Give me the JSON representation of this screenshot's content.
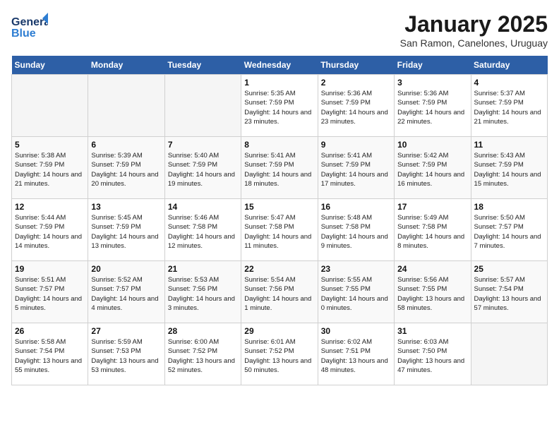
{
  "header": {
    "logo_general": "General",
    "logo_blue": "Blue",
    "month": "January 2025",
    "location": "San Ramon, Canelones, Uruguay"
  },
  "days_of_week": [
    "Sunday",
    "Monday",
    "Tuesday",
    "Wednesday",
    "Thursday",
    "Friday",
    "Saturday"
  ],
  "weeks": [
    [
      {
        "day": "",
        "info": ""
      },
      {
        "day": "",
        "info": ""
      },
      {
        "day": "",
        "info": ""
      },
      {
        "day": "1",
        "info": "Sunrise: 5:35 AM\nSunset: 7:59 PM\nDaylight: 14 hours\nand 23 minutes."
      },
      {
        "day": "2",
        "info": "Sunrise: 5:36 AM\nSunset: 7:59 PM\nDaylight: 14 hours\nand 23 minutes."
      },
      {
        "day": "3",
        "info": "Sunrise: 5:36 AM\nSunset: 7:59 PM\nDaylight: 14 hours\nand 22 minutes."
      },
      {
        "day": "4",
        "info": "Sunrise: 5:37 AM\nSunset: 7:59 PM\nDaylight: 14 hours\nand 21 minutes."
      }
    ],
    [
      {
        "day": "5",
        "info": "Sunrise: 5:38 AM\nSunset: 7:59 PM\nDaylight: 14 hours\nand 21 minutes."
      },
      {
        "day": "6",
        "info": "Sunrise: 5:39 AM\nSunset: 7:59 PM\nDaylight: 14 hours\nand 20 minutes."
      },
      {
        "day": "7",
        "info": "Sunrise: 5:40 AM\nSunset: 7:59 PM\nDaylight: 14 hours\nand 19 minutes."
      },
      {
        "day": "8",
        "info": "Sunrise: 5:41 AM\nSunset: 7:59 PM\nDaylight: 14 hours\nand 18 minutes."
      },
      {
        "day": "9",
        "info": "Sunrise: 5:41 AM\nSunset: 7:59 PM\nDaylight: 14 hours\nand 17 minutes."
      },
      {
        "day": "10",
        "info": "Sunrise: 5:42 AM\nSunset: 7:59 PM\nDaylight: 14 hours\nand 16 minutes."
      },
      {
        "day": "11",
        "info": "Sunrise: 5:43 AM\nSunset: 7:59 PM\nDaylight: 14 hours\nand 15 minutes."
      }
    ],
    [
      {
        "day": "12",
        "info": "Sunrise: 5:44 AM\nSunset: 7:59 PM\nDaylight: 14 hours\nand 14 minutes."
      },
      {
        "day": "13",
        "info": "Sunrise: 5:45 AM\nSunset: 7:59 PM\nDaylight: 14 hours\nand 13 minutes."
      },
      {
        "day": "14",
        "info": "Sunrise: 5:46 AM\nSunset: 7:58 PM\nDaylight: 14 hours\nand 12 minutes."
      },
      {
        "day": "15",
        "info": "Sunrise: 5:47 AM\nSunset: 7:58 PM\nDaylight: 14 hours\nand 11 minutes."
      },
      {
        "day": "16",
        "info": "Sunrise: 5:48 AM\nSunset: 7:58 PM\nDaylight: 14 hours\nand 9 minutes."
      },
      {
        "day": "17",
        "info": "Sunrise: 5:49 AM\nSunset: 7:58 PM\nDaylight: 14 hours\nand 8 minutes."
      },
      {
        "day": "18",
        "info": "Sunrise: 5:50 AM\nSunset: 7:57 PM\nDaylight: 14 hours\nand 7 minutes."
      }
    ],
    [
      {
        "day": "19",
        "info": "Sunrise: 5:51 AM\nSunset: 7:57 PM\nDaylight: 14 hours\nand 5 minutes."
      },
      {
        "day": "20",
        "info": "Sunrise: 5:52 AM\nSunset: 7:57 PM\nDaylight: 14 hours\nand 4 minutes."
      },
      {
        "day": "21",
        "info": "Sunrise: 5:53 AM\nSunset: 7:56 PM\nDaylight: 14 hours\nand 3 minutes."
      },
      {
        "day": "22",
        "info": "Sunrise: 5:54 AM\nSunset: 7:56 PM\nDaylight: 14 hours\nand 1 minute."
      },
      {
        "day": "23",
        "info": "Sunrise: 5:55 AM\nSunset: 7:55 PM\nDaylight: 14 hours\nand 0 minutes."
      },
      {
        "day": "24",
        "info": "Sunrise: 5:56 AM\nSunset: 7:55 PM\nDaylight: 13 hours\nand 58 minutes."
      },
      {
        "day": "25",
        "info": "Sunrise: 5:57 AM\nSunset: 7:54 PM\nDaylight: 13 hours\nand 57 minutes."
      }
    ],
    [
      {
        "day": "26",
        "info": "Sunrise: 5:58 AM\nSunset: 7:54 PM\nDaylight: 13 hours\nand 55 minutes."
      },
      {
        "day": "27",
        "info": "Sunrise: 5:59 AM\nSunset: 7:53 PM\nDaylight: 13 hours\nand 53 minutes."
      },
      {
        "day": "28",
        "info": "Sunrise: 6:00 AM\nSunset: 7:52 PM\nDaylight: 13 hours\nand 52 minutes."
      },
      {
        "day": "29",
        "info": "Sunrise: 6:01 AM\nSunset: 7:52 PM\nDaylight: 13 hours\nand 50 minutes."
      },
      {
        "day": "30",
        "info": "Sunrise: 6:02 AM\nSunset: 7:51 PM\nDaylight: 13 hours\nand 48 minutes."
      },
      {
        "day": "31",
        "info": "Sunrise: 6:03 AM\nSunset: 7:50 PM\nDaylight: 13 hours\nand 47 minutes."
      },
      {
        "day": "",
        "info": ""
      }
    ]
  ]
}
